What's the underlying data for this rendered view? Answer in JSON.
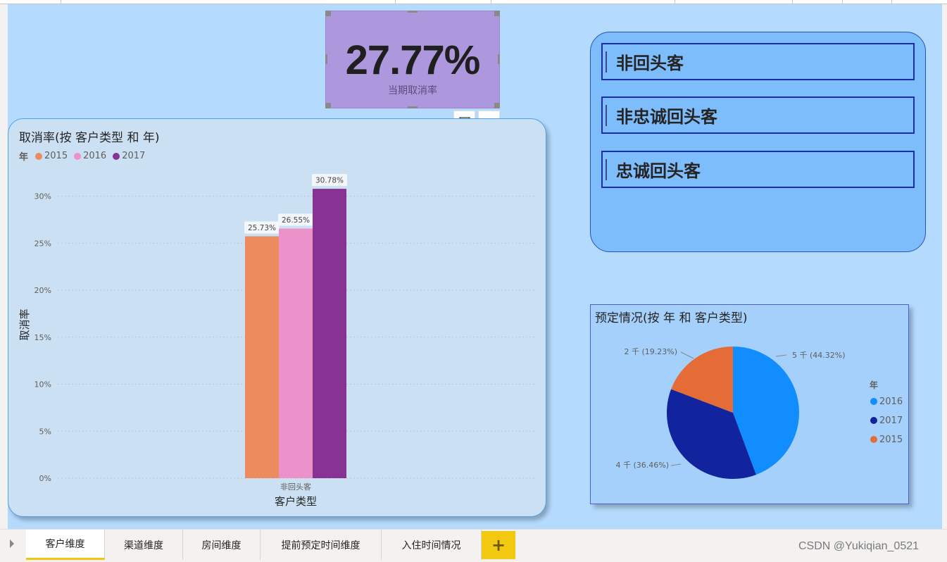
{
  "kpi": {
    "value": "27.77%",
    "label": "当期取消率"
  },
  "bar_card": {
    "title": "取消率(按 客户类型 和 年)",
    "legend_title": "年",
    "xlabel": "客户类型",
    "ylabel": "取消率"
  },
  "slicer": {
    "items": [
      "非回头客",
      "非忠诚回头客",
      "忠诚回头客"
    ]
  },
  "pie_card": {
    "title": "预定情况(按 年 和 客户类型)",
    "legend_title": "年"
  },
  "tabs": {
    "items": [
      "客户维度",
      "渠道维度",
      "房间维度",
      "提前预定时间维度",
      "入住时间情况"
    ],
    "active_index": 0,
    "add_label": "+"
  },
  "watermark": "CSDN @Yukiqian_0521",
  "colors": {
    "c2015": "#eb8b5e",
    "c2016": "#ed91cb",
    "c2017": "#883294",
    "pie2016": "#118dff",
    "pie2017": "#12239e",
    "pie2015": "#e66c37"
  },
  "chart_data": [
    {
      "type": "bar",
      "title": "取消率(按 客户类型 和 年)",
      "xlabel": "客户类型",
      "ylabel": "取消率",
      "categories": [
        "非回头客"
      ],
      "series": [
        {
          "name": "2015",
          "values": [
            25.73
          ],
          "labels": [
            "25.73%"
          ]
        },
        {
          "name": "2016",
          "values": [
            26.55
          ],
          "labels": [
            "26.55%"
          ]
        },
        {
          "name": "2017",
          "values": [
            30.78
          ],
          "labels": [
            "30.78%"
          ]
        }
      ],
      "yticks": [
        "0%",
        "5%",
        "10%",
        "15%",
        "20%",
        "25%",
        "30%"
      ],
      "ylim": [
        0,
        30
      ],
      "grid": true,
      "legend_placement": "top-left"
    },
    {
      "type": "pie",
      "title": "预定情况(按 年 和 客户类型)",
      "slices": [
        {
          "name": "2016",
          "value": 44.32,
          "label": "5 千 (44.32%)"
        },
        {
          "name": "2017",
          "value": 36.46,
          "label": "4 千 (36.46%)"
        },
        {
          "name": "2015",
          "value": 19.23,
          "label": "2 千 (19.23%)"
        }
      ],
      "legend_placement": "right"
    }
  ]
}
